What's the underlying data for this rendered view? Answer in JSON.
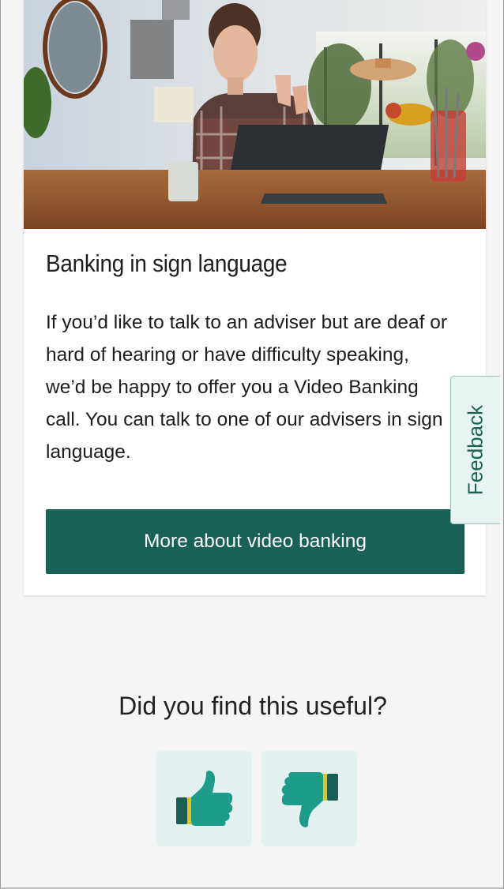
{
  "card": {
    "image_alt": "Woman signing in front of a laptop at a kitchen table",
    "title": "Banking in sign language",
    "body": " If you’d like to talk to an adviser but are deaf or hard of hearing or have difficulty speaking, we’d be happy to offer you a Video Banking call. You can talk to one of our advisers in sign language.",
    "cta_label": "More about video banking"
  },
  "feedback_tab": {
    "label": "Feedback"
  },
  "rating": {
    "question": "Did you find this useful?",
    "up_icon": "thumbs-up-icon",
    "down_icon": "thumbs-down-icon"
  },
  "colors": {
    "primary": "#186156",
    "icon_teal": "#1e9c8a",
    "vote_bg": "#e3f2f1",
    "band_yellow": "#e3c21a"
  }
}
